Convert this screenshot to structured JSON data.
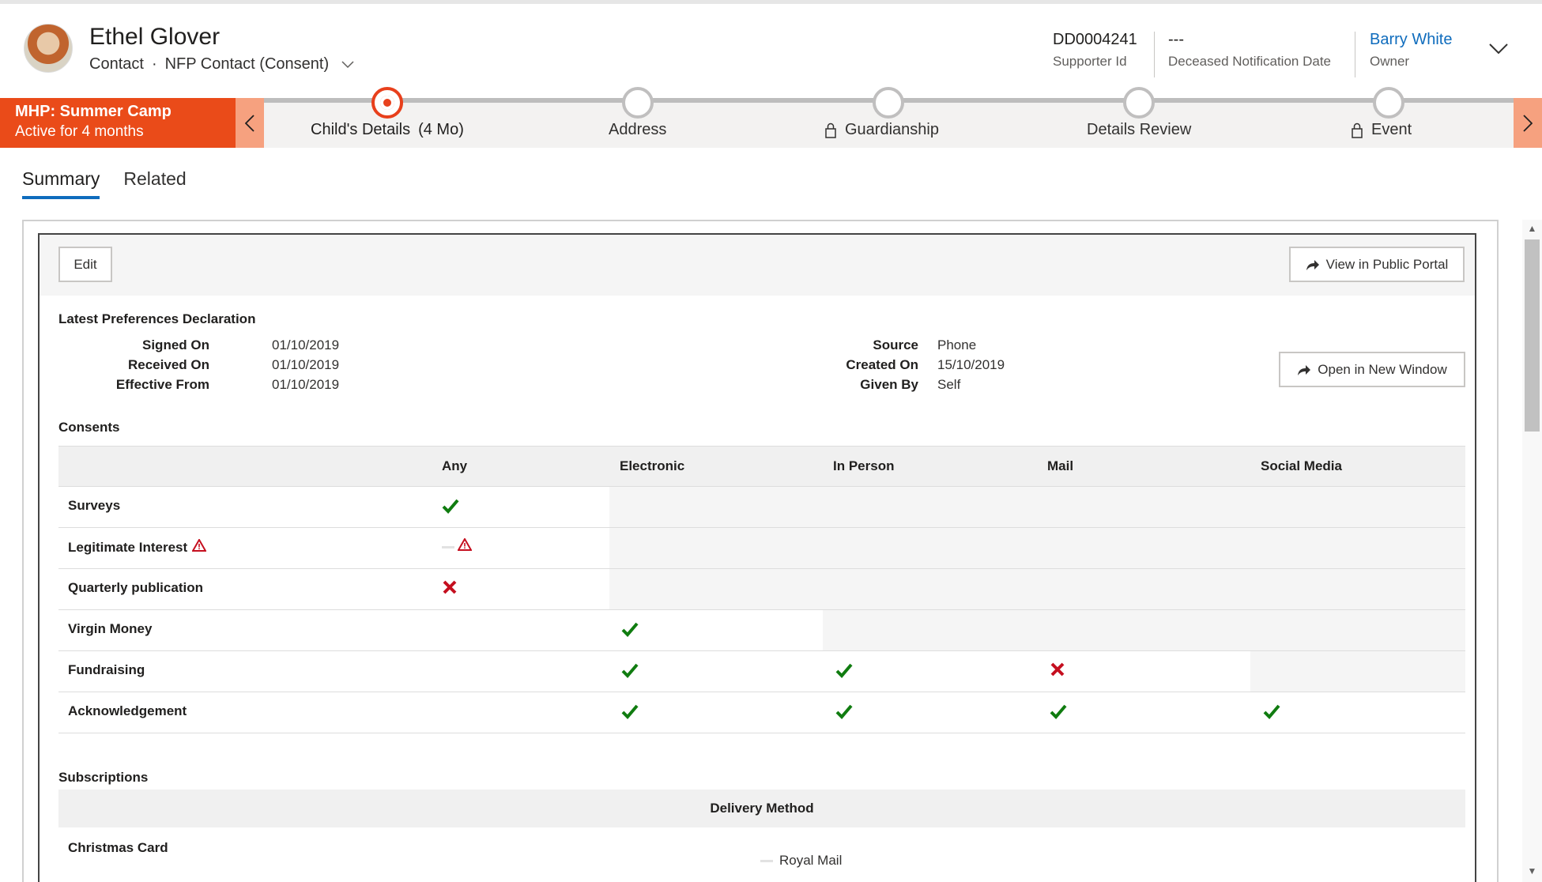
{
  "header": {
    "name": "Ethel Glover",
    "entity": "Contact",
    "separator": "·",
    "form": "NFP Contact (Consent)",
    "fields": [
      {
        "value": "DD0004241",
        "label": "Supporter Id"
      },
      {
        "value": "---",
        "label": "Deceased Notification Date"
      },
      {
        "value": "Barry White",
        "label": "Owner"
      }
    ]
  },
  "bpf": {
    "process_name": "MHP: Summer Camp",
    "process_status": "Active for 4 months",
    "stages": [
      {
        "label": "Child's Details",
        "duration": "(4 Mo)",
        "active": true,
        "locked": false
      },
      {
        "label": "Address",
        "active": false,
        "locked": false
      },
      {
        "label": "Guardianship",
        "active": false,
        "locked": true
      },
      {
        "label": "Details Review",
        "active": false,
        "locked": false
      },
      {
        "label": "Event",
        "active": false,
        "locked": true
      }
    ]
  },
  "tabs": [
    "Summary",
    "Related"
  ],
  "toolbar": {
    "edit_label": "Edit",
    "portal_label": "View in Public Portal",
    "newwin_label": "Open in New Window"
  },
  "declaration": {
    "title": "Latest Preferences Declaration",
    "left": [
      {
        "key": "Signed On",
        "value": "01/10/2019"
      },
      {
        "key": "Received On",
        "value": "01/10/2019"
      },
      {
        "key": "Effective From",
        "value": "01/10/2019"
      }
    ],
    "right": [
      {
        "key": "Source",
        "value": "Phone"
      },
      {
        "key": "Created On",
        "value": "15/10/2019"
      },
      {
        "key": "Given By",
        "value": "Self"
      }
    ]
  },
  "consents": {
    "title": "Consents",
    "columns": [
      "Any",
      "Electronic",
      "In Person",
      "Mail",
      "Social Media"
    ],
    "rows": [
      {
        "name": "Surveys",
        "warning": false,
        "cells": [
          "yes",
          null,
          null,
          null,
          null
        ]
      },
      {
        "name": "Legitimate Interest",
        "warning": true,
        "cells": [
          "warn",
          null,
          null,
          null,
          null
        ]
      },
      {
        "name": "Quarterly publication",
        "warning": false,
        "cells": [
          "no",
          null,
          null,
          null,
          null
        ]
      },
      {
        "name": "Virgin Money",
        "warning": false,
        "cells": [
          null,
          "yes",
          null,
          null,
          null
        ]
      },
      {
        "name": "Fundraising",
        "warning": false,
        "cells": [
          null,
          "yes",
          "yes",
          "no",
          null
        ]
      },
      {
        "name": "Acknowledgement",
        "warning": false,
        "cells": [
          null,
          "yes",
          "yes",
          "yes",
          "yes"
        ]
      }
    ]
  },
  "subscriptions": {
    "title": "Subscriptions",
    "column": "Delivery Method",
    "rows": [
      {
        "name": "Christmas Card",
        "value": "Royal Mail"
      }
    ]
  },
  "colors": {
    "accent": "#ea4b19",
    "link": "#0f6cbd",
    "check": "#107c10",
    "cross": "#c50f1f"
  }
}
